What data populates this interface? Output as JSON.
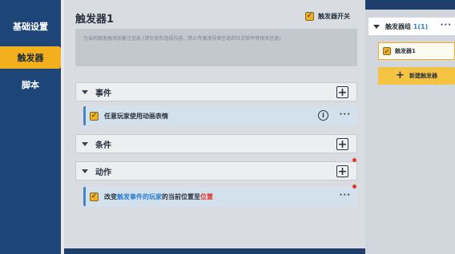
{
  "sidebar": {
    "items": [
      {
        "label": "基础设置"
      },
      {
        "label": "触发器"
      },
      {
        "label": "脚本"
      }
    ],
    "active_index": 1
  },
  "editor": {
    "title": "触发器1",
    "switch_label": "触发器开关",
    "switch_checked": true,
    "note_placeholder": "为当前触发器添加备注信息 (请勿发布违规内容，禁止传播诱导类信息和社交软件等相关信息)",
    "sections": [
      {
        "label": "事件",
        "rows": [
          {
            "segments": [
              {
                "text": "任意玩家使用动画表情",
                "color": "default"
              }
            ],
            "has_info": true
          }
        ]
      },
      {
        "label": "条件",
        "rows": []
      },
      {
        "label": "动作",
        "rows": [
          {
            "segments": [
              {
                "text": "改变",
                "color": "default"
              },
              {
                "text": "触发事件的玩家",
                "color": "blue"
              },
              {
                "text": "的当前位置至",
                "color": "default"
              },
              {
                "text": "位置",
                "color": "red"
              }
            ],
            "has_info": false
          }
        ]
      }
    ],
    "add_icon": "plus-icon",
    "more_icon": "ellipsis-icon",
    "info_icon": "info-circle-icon",
    "info_glyph": "i",
    "more_glyph": "···",
    "add_glyph": "+"
  },
  "groups": {
    "group_name": "触发器组",
    "group_count": "1(1)",
    "triggers": [
      {
        "label": "触发器1",
        "checked": true
      }
    ],
    "new_button_label": "新建触发器",
    "new_button_glyph": "+"
  },
  "colors": {
    "accent_yellow": "#f2b01e",
    "link_blue": "#2e7fd0",
    "alert_red": "#e0332a",
    "sidebar_bg": "#1d4577"
  }
}
